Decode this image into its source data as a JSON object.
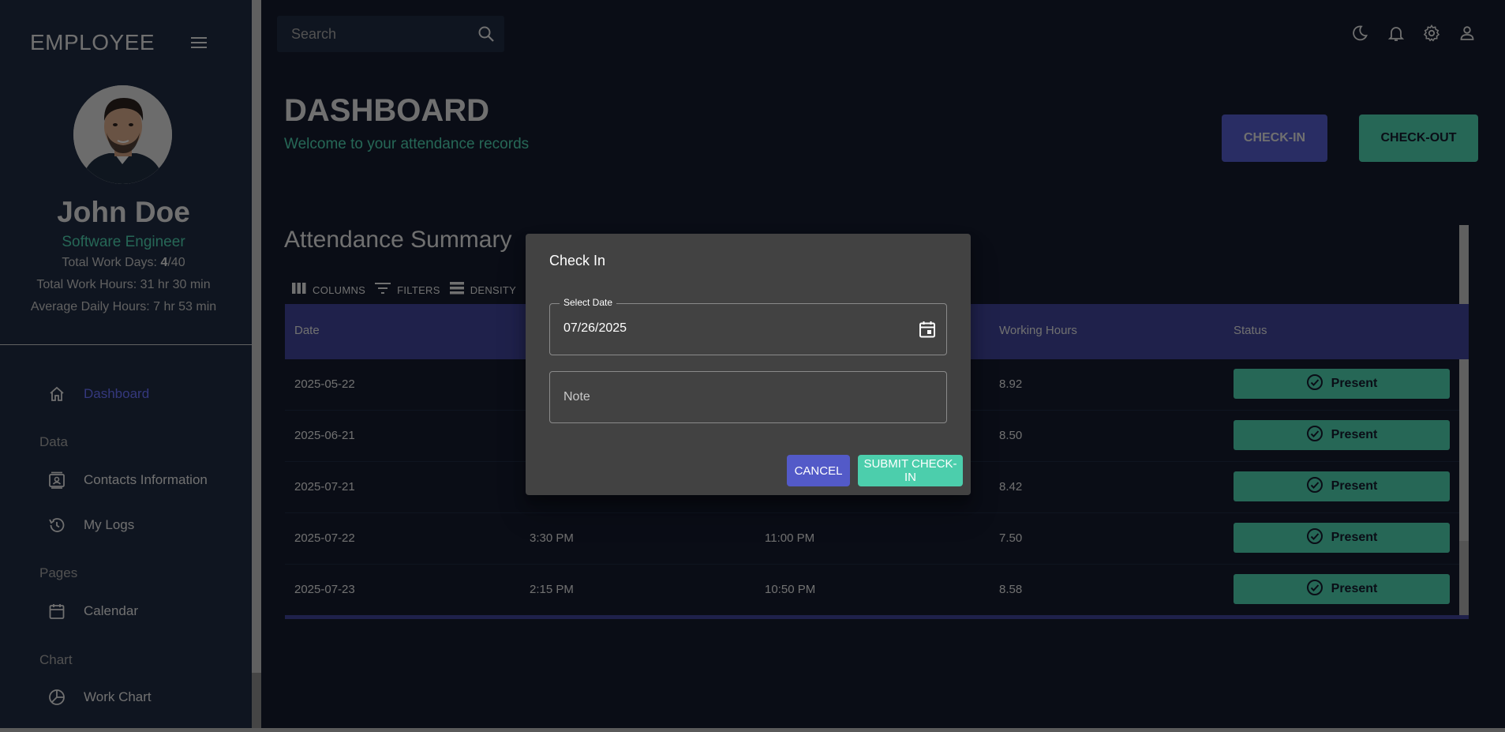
{
  "sidebar": {
    "brand": "EMPLOYEE",
    "profile": {
      "name": "John Doe",
      "role": "Software Engineer",
      "work_days_label": "Total Work Days: ",
      "work_days_done": "4",
      "work_days_total": "/40",
      "work_hours": "Total Work Hours: 31 hr 30 min",
      "avg_hours": "Average Daily Hours: 7 hr 53 min"
    },
    "nav": {
      "dashboard": "Dashboard",
      "section_data": "Data",
      "contacts": "Contacts Information",
      "logs": "My Logs",
      "section_pages": "Pages",
      "calendar": "Calendar",
      "section_chart": "Chart",
      "work_chart": "Work Chart"
    }
  },
  "topbar": {
    "search_placeholder": "Search",
    "icons": [
      "moon-icon",
      "bell-icon",
      "gear-icon",
      "person-icon"
    ]
  },
  "header": {
    "title": "DASHBOARD",
    "subtitle": "Welcome to your attendance records",
    "checkin_label": "CHECK-IN",
    "checkout_label": "CHECK-OUT"
  },
  "summary": {
    "title": "Attendance Summary",
    "toolbar": {
      "columns": "COLUMNS",
      "filters": "FILTERS",
      "density": "DENSITY"
    },
    "columns": [
      "Date",
      "",
      "",
      "Working Hours",
      "Status"
    ],
    "rows": [
      {
        "date": "2025-05-22",
        "check_in": "",
        "check_out": "",
        "hours": "8.92",
        "status": "Present"
      },
      {
        "date": "2025-06-21",
        "check_in": "",
        "check_out": "",
        "hours": "8.50",
        "status": "Present"
      },
      {
        "date": "2025-07-21",
        "check_in": "",
        "check_out": "",
        "hours": "8.42",
        "status": "Present"
      },
      {
        "date": "2025-07-22",
        "check_in": "3:30 PM",
        "check_out": "11:00 PM",
        "hours": "7.50",
        "status": "Present"
      },
      {
        "date": "2025-07-23",
        "check_in": "2:15 PM",
        "check_out": "10:50 PM",
        "hours": "8.58",
        "status": "Present"
      }
    ]
  },
  "dialog": {
    "title": "Check In",
    "date_label": "Select Date",
    "date_value": "07/26/2025",
    "note_placeholder": "Note",
    "cancel_label": "CANCEL",
    "submit_label": "SUBMIT CHECK-IN"
  },
  "colors": {
    "background": "#141b2d",
    "panel": "#1f2a40",
    "accent_blue": "#535ac8",
    "accent_green": "#4cceac",
    "header_blue": "#3e4396",
    "dialog_bg": "#424242"
  }
}
